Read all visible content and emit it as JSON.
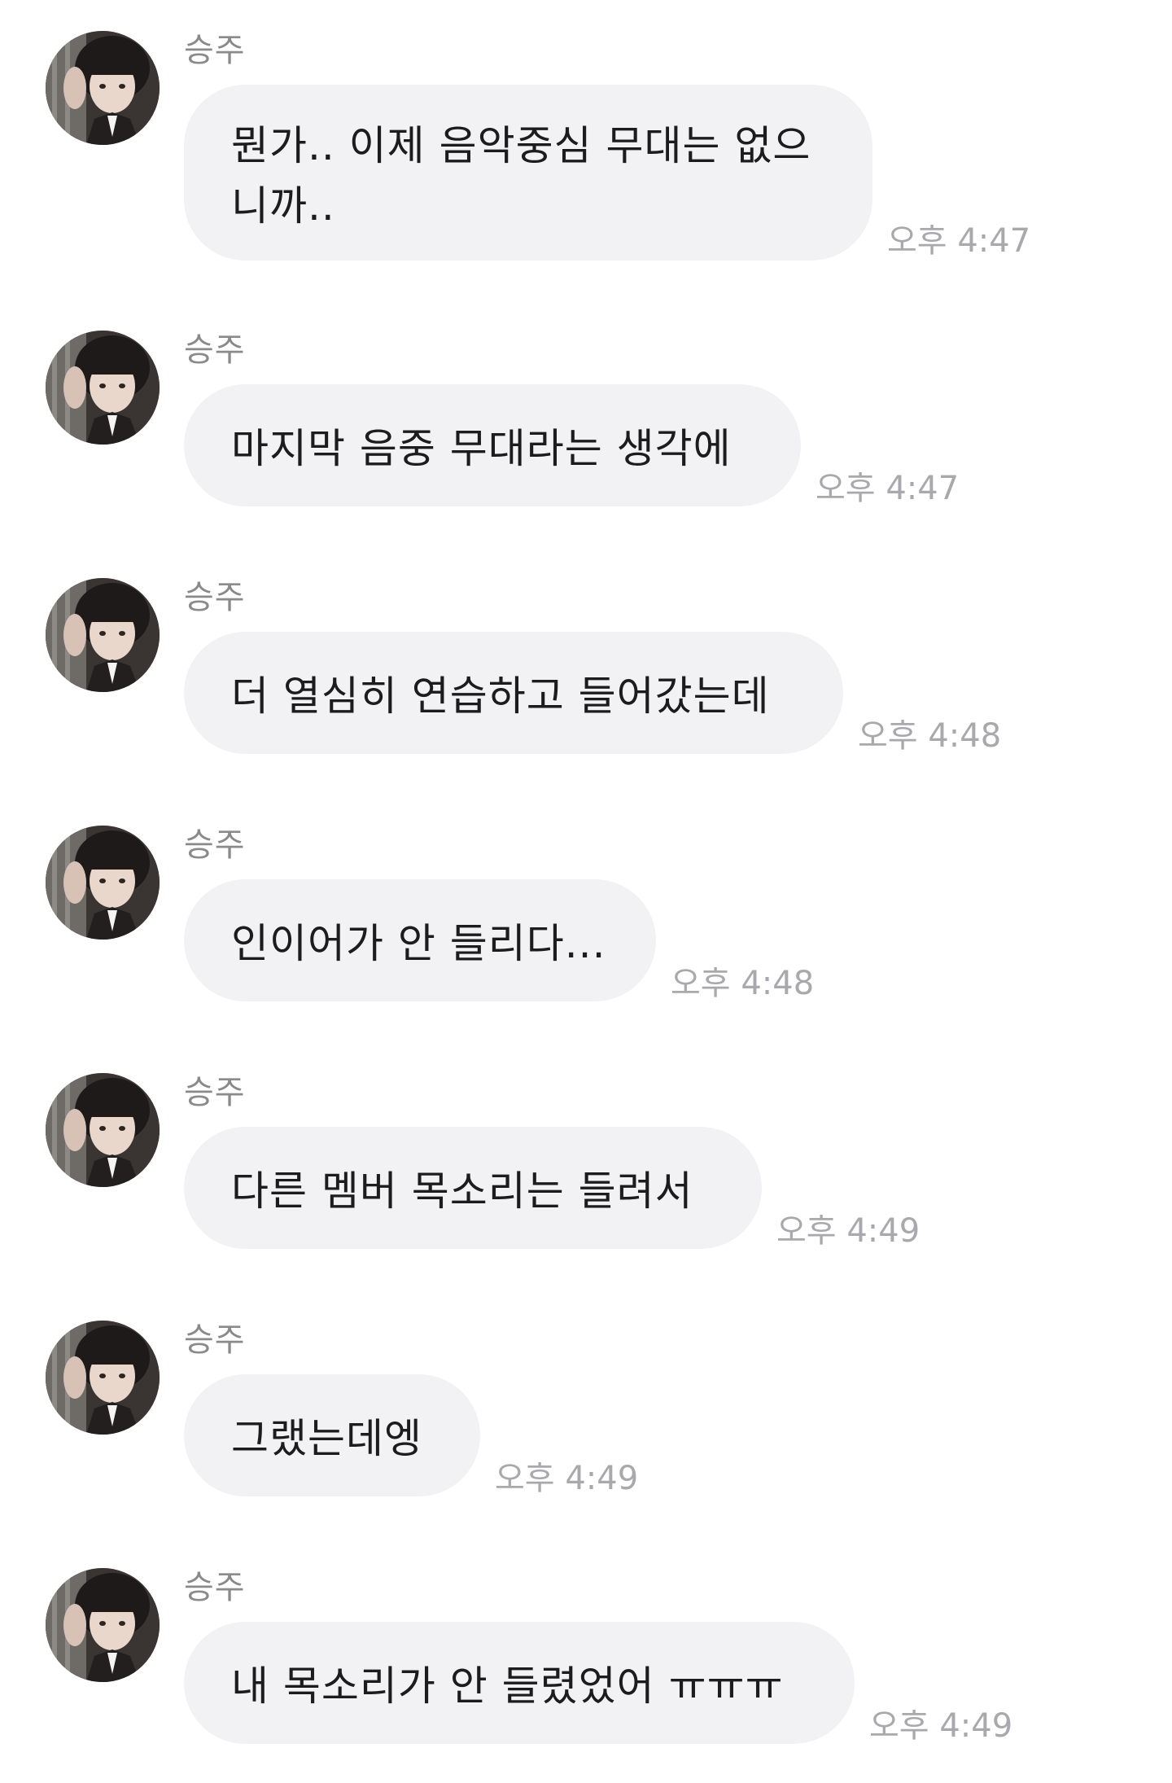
{
  "messages": [
    {
      "sender": "승주",
      "text": "뭔가.. 이제 음악중심 무대는 없으니까..",
      "time": "오후 4:47"
    },
    {
      "sender": "승주",
      "text": "마지막 음중 무대라는 생각에",
      "time": "오후 4:47"
    },
    {
      "sender": "승주",
      "text": "더 열심히 연습하고 들어갔는데",
      "time": "오후 4:48"
    },
    {
      "sender": "승주",
      "text": "인이어가 안 들리다...",
      "time": "오후 4:48"
    },
    {
      "sender": "승주",
      "text": "다른 멤버 목소리는 들려서",
      "time": "오후 4:49"
    },
    {
      "sender": "승주",
      "text": "그랬는데엥",
      "time": "오후 4:49"
    },
    {
      "sender": "승주",
      "text": "내 목소리가 안 들렸었어 ㅠㅠㅠ",
      "time": "오후 4:49"
    }
  ],
  "avatar_icon": "profile-photo-icon",
  "colors": {
    "bubble": "#f2f2f4",
    "message_text": "#1c1c1c",
    "sender_text": "#8a8a8a",
    "time_text": "#a9a9ad"
  }
}
